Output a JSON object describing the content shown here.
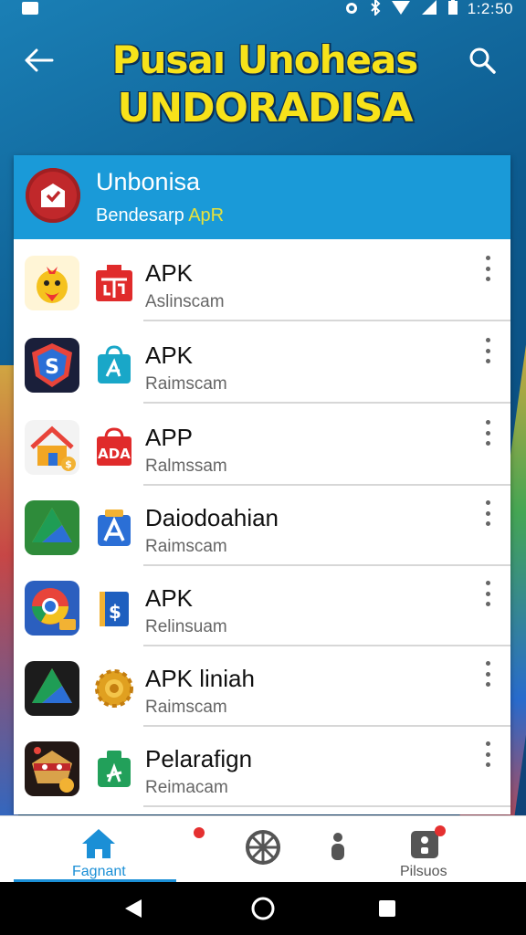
{
  "status_bar": {
    "time": "1:2:50"
  },
  "header": {
    "title_line1": "Pusaı Unoheas",
    "title_line2": "UNDORADISA"
  },
  "panel": {
    "brand_name": "Unbonisa",
    "brand_sub_main": "Bendesarp",
    "brand_sub_accent": "ApR"
  },
  "apps": [
    {
      "title": "APK",
      "subtitle": "Aslinscam",
      "icon": "chick-mascot-icon",
      "small_icon": "red-store-icon"
    },
    {
      "title": "APK",
      "subtitle": "Raimscam",
      "icon": "shield-s-icon",
      "small_icon": "teal-bag-icon"
    },
    {
      "title": "APP",
      "subtitle": "Ralmssam",
      "icon": "house-icon",
      "small_icon": "red-bag-icon"
    },
    {
      "title": "Daiodoahian",
      "subtitle": "Raimscam",
      "icon": "drive-triangle-icon",
      "small_icon": "blue-bag-a-icon"
    },
    {
      "title": "APK",
      "subtitle": "Relinsuam",
      "icon": "chrome-icon",
      "small_icon": "blue-card-icon"
    },
    {
      "title": "APK liniah",
      "subtitle": "Raimscam",
      "icon": "drive-triangle-dark-icon",
      "small_icon": "gold-gear-icon"
    },
    {
      "title": "Pelarafign",
      "subtitle": "Reimacam",
      "icon": "ninja-mascot-icon",
      "small_icon": "green-bag-icon"
    }
  ],
  "bottom_nav": {
    "home_label": "Fagnant",
    "profile_label": "Pilsuos"
  },
  "colors": {
    "accent": "#1a9ad8",
    "title_yellow": "#f7e21a",
    "home_active": "#1b8fd6"
  }
}
